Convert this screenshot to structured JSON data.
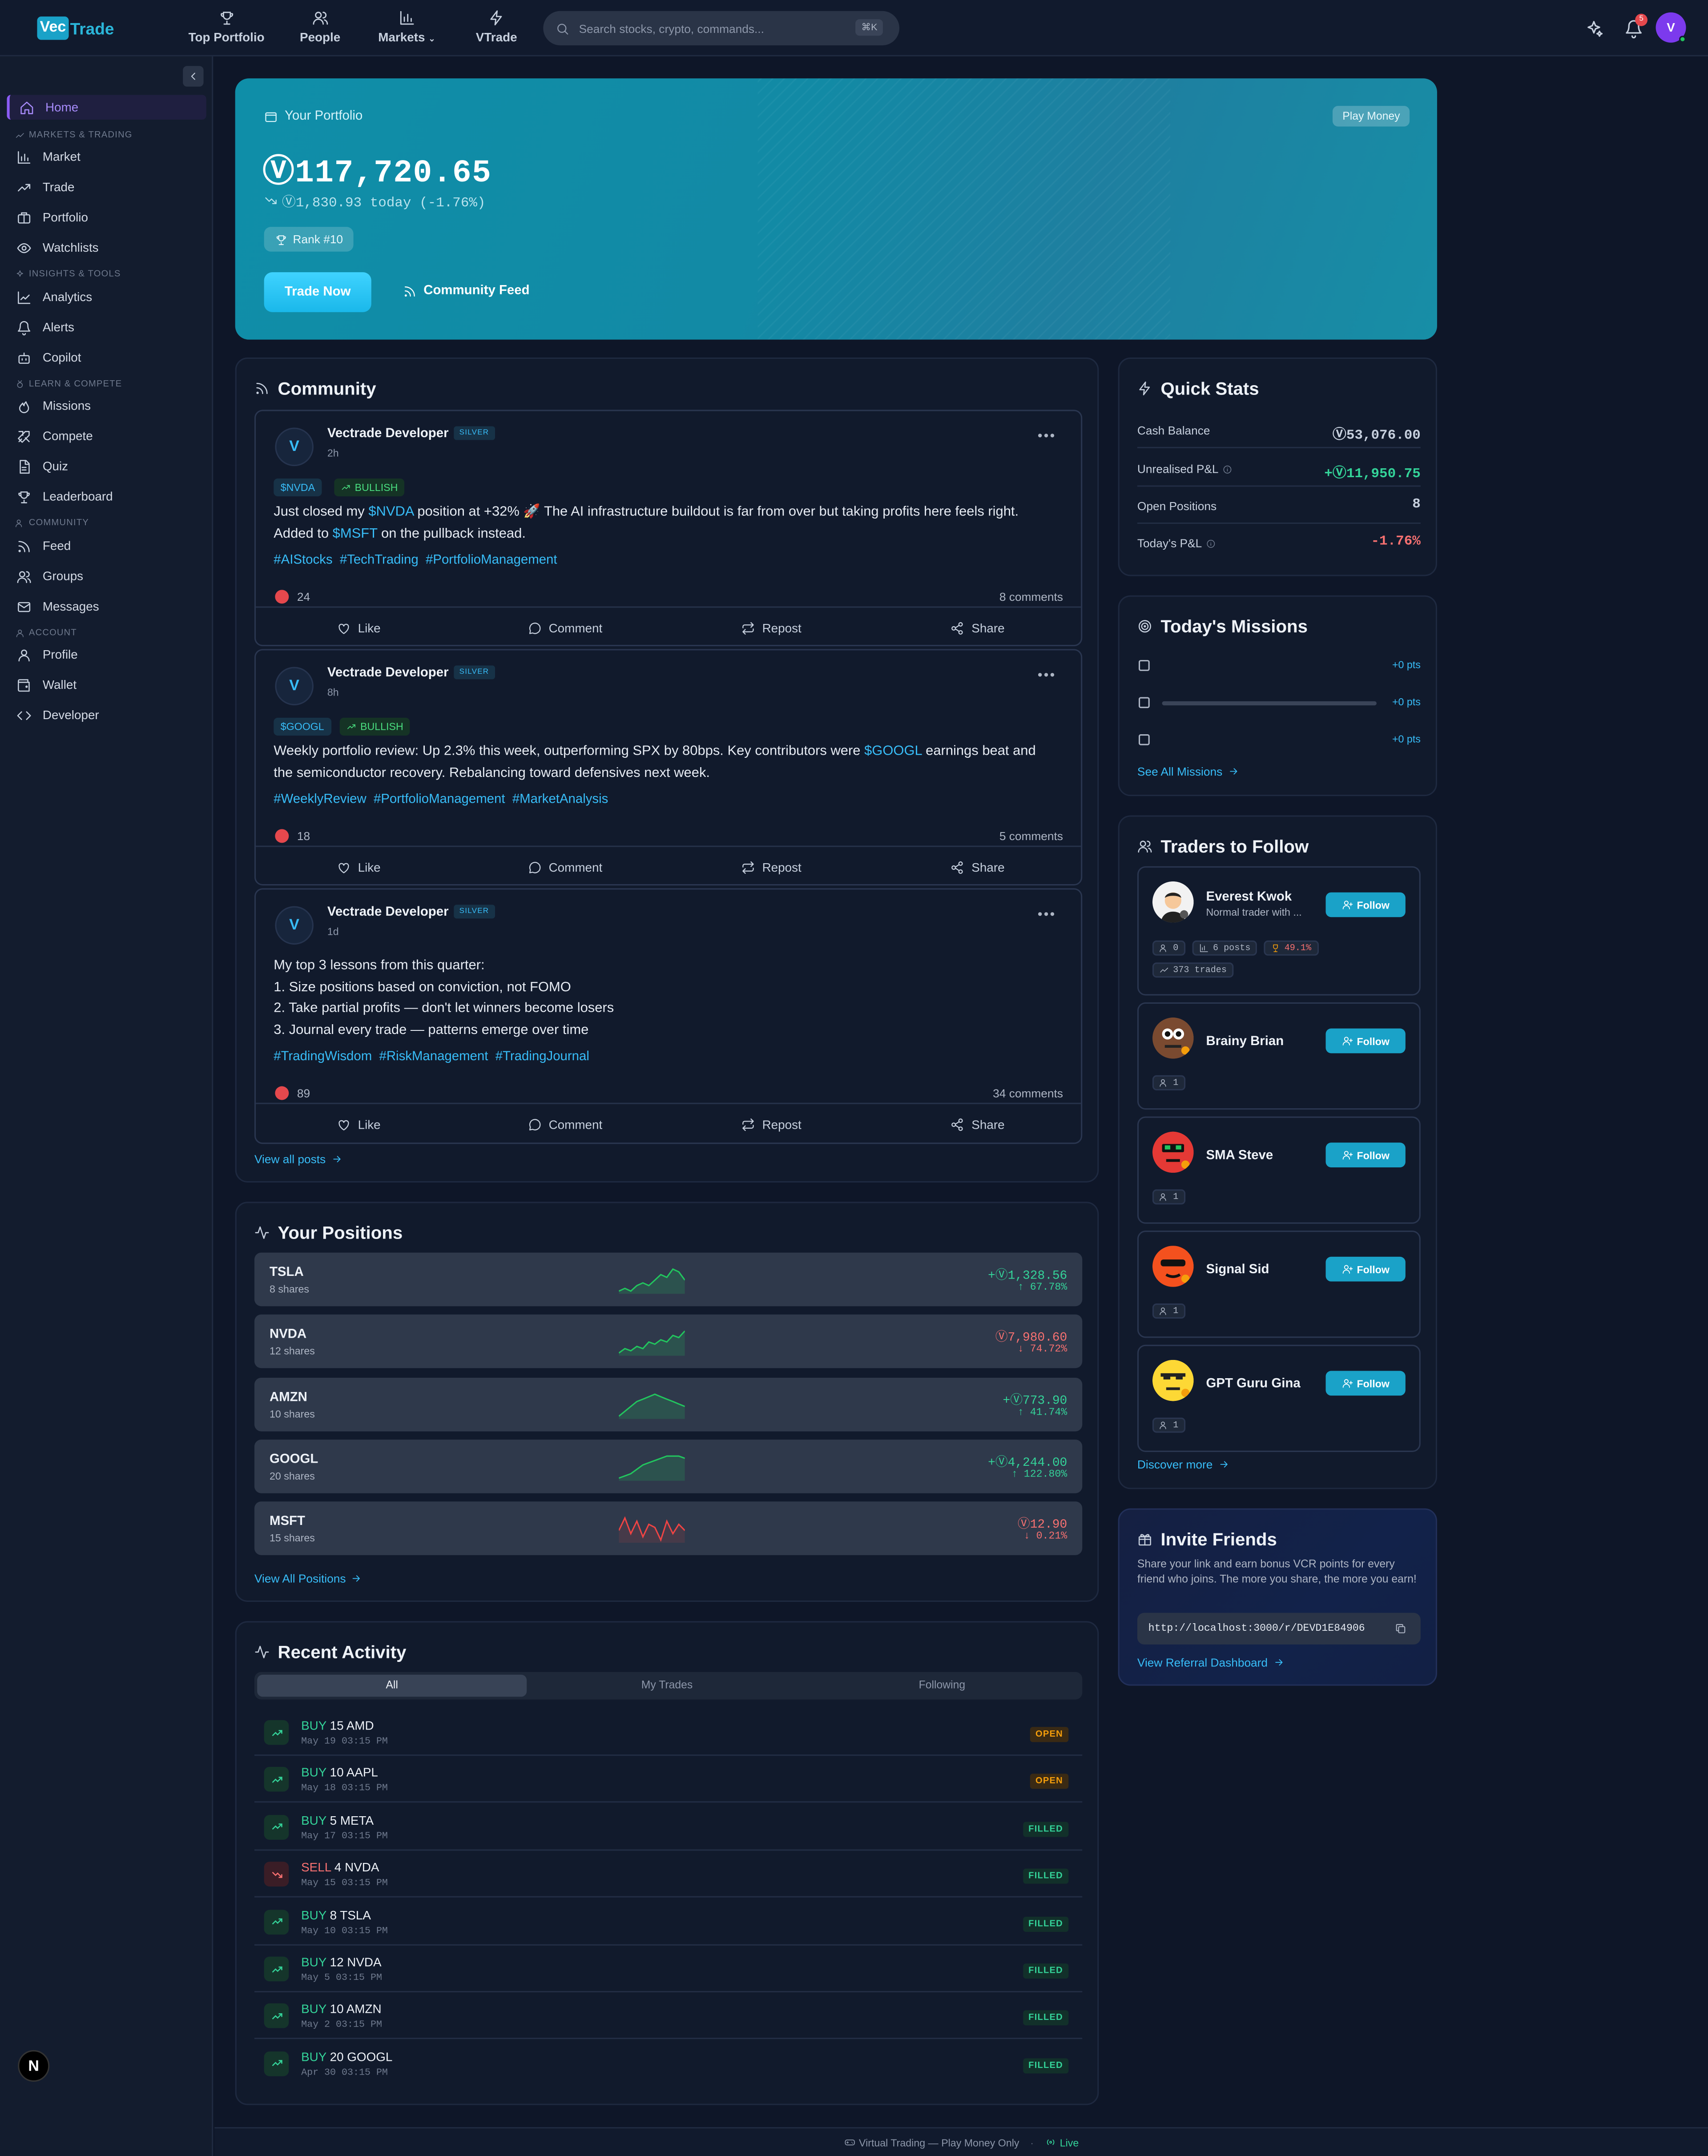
{
  "brand": {
    "logo_box": "Vec",
    "logo_text": "Trade"
  },
  "topnav": [
    {
      "label": "Top Portfolio",
      "icon": "trophy-icon"
    },
    {
      "label": "People",
      "icon": "users-icon"
    },
    {
      "label": "Markets",
      "icon": "bar-chart-icon"
    },
    {
      "label": "VTrade",
      "icon": "zap-icon"
    }
  ],
  "search": {
    "placeholder": "Search stocks, crypto, commands...",
    "shortcut": "⌘K"
  },
  "header_right": {
    "notification_count": "5",
    "avatar_initial": "V"
  },
  "sidebar": {
    "home": "Home",
    "sections": {
      "markets": "MARKETS & TRADING",
      "insights": "INSIGHTS & TOOLS",
      "learn": "LEARN & COMPETE",
      "community": "COMMUNITY",
      "account": "ACCOUNT"
    },
    "items": {
      "market": "Market",
      "trade": "Trade",
      "portfolio": "Portfolio",
      "watchlists": "Watchlists",
      "analytics": "Analytics",
      "alerts": "Alerts",
      "copilot": "Copilot",
      "missions": "Missions",
      "compete": "Compete",
      "quiz": "Quiz",
      "leaderboard": "Leaderboard",
      "feed": "Feed",
      "groups": "Groups",
      "messages": "Messages",
      "profile": "Profile",
      "wallet": "Wallet",
      "developer": "Developer"
    },
    "next_badge": "N"
  },
  "hero": {
    "label": "Your Portfolio",
    "badge": "Play Money",
    "balance": "Ⓥ117,720.65",
    "change": "Ⓥ1,830.93 today (-1.76%)",
    "rank": "Rank #10",
    "trade_button": "Trade Now",
    "feed_link": "Community Feed"
  },
  "community": {
    "title": "Community",
    "posts": [
      {
        "author": "Vectrade Developer",
        "avatar": "V",
        "tier": "SILVER",
        "time": "2h",
        "ticker": "$NVDA",
        "sentiment": "BULLISH",
        "line1_pre": "Just closed my ",
        "line1_ticker": "$NVDA",
        "line1_post": " position at +32% 🚀 The AI infrastructure buildout is far from over but taking profits here feels right.",
        "line2_pre": "Added to ",
        "line2_ticker": "$MSFT",
        "line2_post": " on the pullback instead.",
        "tags": "#AIStocks  #TechTrading  #PortfolioManagement",
        "likes": "24",
        "comments": "8 comments"
      },
      {
        "author": "Vectrade Developer",
        "avatar": "V",
        "tier": "SILVER",
        "time": "8h",
        "ticker": "$GOOGL",
        "sentiment": "BULLISH",
        "line1_pre": "Weekly portfolio review: Up 2.3% this week, outperforming SPX by 80bps. Key contributors were ",
        "line1_ticker": "$GOOGL",
        "line1_post": " earnings beat and",
        "line2_pre": "the semiconductor recovery. Rebalancing toward defensives next week.",
        "line2_ticker": "",
        "line2_post": "",
        "tags": "#WeeklyReview  #PortfolioManagement  #MarketAnalysis",
        "likes": "18",
        "comments": "5 comments"
      },
      {
        "author": "Vectrade Developer",
        "avatar": "V",
        "tier": "SILVER",
        "time": "1d",
        "lines": [
          "My top 3 lessons from this quarter:",
          "1. Size positions based on conviction, not FOMO",
          "2. Take partial profits — don't let winners become losers",
          "3. Journal every trade — patterns emerge over time"
        ],
        "tags": "#TradingWisdom  #RiskManagement  #TradingJournal",
        "likes": "89",
        "comments": "34 comments"
      }
    ],
    "actions": {
      "like": "Like",
      "comment": "Comment",
      "repost": "Repost",
      "share": "Share"
    },
    "view_all": "View all posts"
  },
  "positions": {
    "title": "Your Positions",
    "rows": [
      {
        "symbol": "TSLA",
        "shares": "8 shares",
        "pl": "+Ⓥ1,328.56",
        "pct": "↑ 67.78%",
        "up": true,
        "spark": [
          4,
          5,
          4,
          6,
          7,
          6,
          8,
          10,
          9,
          12,
          11,
          8
        ]
      },
      {
        "symbol": "NVDA",
        "shares": "12 shares",
        "pl": "Ⓥ7,980.60",
        "pct": "↓ 74.72%",
        "up": true,
        "color": "red",
        "spark": [
          3,
          5,
          4,
          6,
          5,
          8,
          7,
          9,
          8,
          11,
          10,
          13
        ]
      },
      {
        "symbol": "AMZN",
        "shares": "10 shares",
        "pl": "+Ⓥ773.90",
        "pct": "↑ 41.74%",
        "up": true,
        "spark": [
          3,
          5,
          7,
          9,
          10,
          11,
          12,
          11,
          10,
          9,
          8,
          7
        ]
      },
      {
        "symbol": "GOOGL",
        "shares": "20 shares",
        "pl": "+Ⓥ4,244.00",
        "pct": "↑ 122.80%",
        "up": true,
        "spark": [
          2,
          3,
          4,
          6,
          8,
          9,
          10,
          11,
          12,
          12,
          12,
          11
        ]
      },
      {
        "symbol": "MSFT",
        "shares": "15 shares",
        "pl": "Ⓥ12.90",
        "pct": "↓ 0.21%",
        "up": false,
        "spark": [
          8,
          12,
          7,
          11,
          6,
          10,
          9,
          5,
          11,
          7,
          10,
          8
        ]
      }
    ],
    "view_all": "View All Positions"
  },
  "activity": {
    "title": "Recent Activity",
    "tabs": [
      "All",
      "My Trades",
      "Following"
    ],
    "rows": [
      {
        "side": "BUY",
        "text": "15 AMD",
        "date": "May 19 03:15 PM",
        "status": "OPEN"
      },
      {
        "side": "BUY",
        "text": "10 AAPL",
        "date": "May 18 03:15 PM",
        "status": "OPEN"
      },
      {
        "side": "BUY",
        "text": "5 META",
        "date": "May 17 03:15 PM",
        "status": "FILLED"
      },
      {
        "side": "SELL",
        "text": "4 NVDA",
        "date": "May 15 03:15 PM",
        "status": "FILLED"
      },
      {
        "side": "BUY",
        "text": "8 TSLA",
        "date": "May 10 03:15 PM",
        "status": "FILLED"
      },
      {
        "side": "BUY",
        "text": "12 NVDA",
        "date": "May 5 03:15 PM",
        "status": "FILLED"
      },
      {
        "side": "BUY",
        "text": "10 AMZN",
        "date": "May 2 03:15 PM",
        "status": "FILLED"
      },
      {
        "side": "BUY",
        "text": "20 GOOGL",
        "date": "Apr 30 03:15 PM",
        "status": "FILLED"
      }
    ]
  },
  "quick_stats": {
    "title": "Quick Stats",
    "rows": [
      {
        "label": "Cash Balance",
        "value": "Ⓥ53,076.00",
        "tone": "neutral"
      },
      {
        "label": "Unrealised P&L",
        "value": "+Ⓥ11,950.75",
        "tone": "green"
      },
      {
        "label": "Open Positions",
        "value": "8",
        "tone": "neutral"
      },
      {
        "label": "Today's P&L",
        "value": "-1.76%",
        "tone": "red"
      }
    ]
  },
  "missions": {
    "title": "Today's Missions",
    "rows": [
      {
        "pts": "+0 pts"
      },
      {
        "pts": "+0 pts",
        "progress": 0
      },
      {
        "pts": "+0 pts"
      }
    ],
    "see_all": "See All Missions"
  },
  "traders": {
    "title": "Traders to Follow",
    "follow_label": "Follow",
    "list": [
      {
        "name": "Everest Kwok",
        "bio": "Normal trader with ...",
        "followers": "0",
        "posts": "6 posts",
        "winrate": "49.1%",
        "trades": "373 trades"
      },
      {
        "name": "Brainy Brian",
        "followers": "1"
      },
      {
        "name": "SMA Steve",
        "followers": "1"
      },
      {
        "name": "Signal Sid",
        "followers": "1"
      },
      {
        "name": "GPT Guru Gina",
        "followers": "1"
      }
    ],
    "discover": "Discover more"
  },
  "invite": {
    "title": "Invite Friends",
    "text": "Share your link and earn bonus VCR points for every friend who joins. The more you share, the more you earn!",
    "link": "http://localhost:3000/r/DEVD1E84906",
    "dashboard": "View Referral Dashboard"
  },
  "footer": {
    "text": "Virtual Trading — Play Money Only",
    "sep": "·",
    "live": "Live"
  }
}
